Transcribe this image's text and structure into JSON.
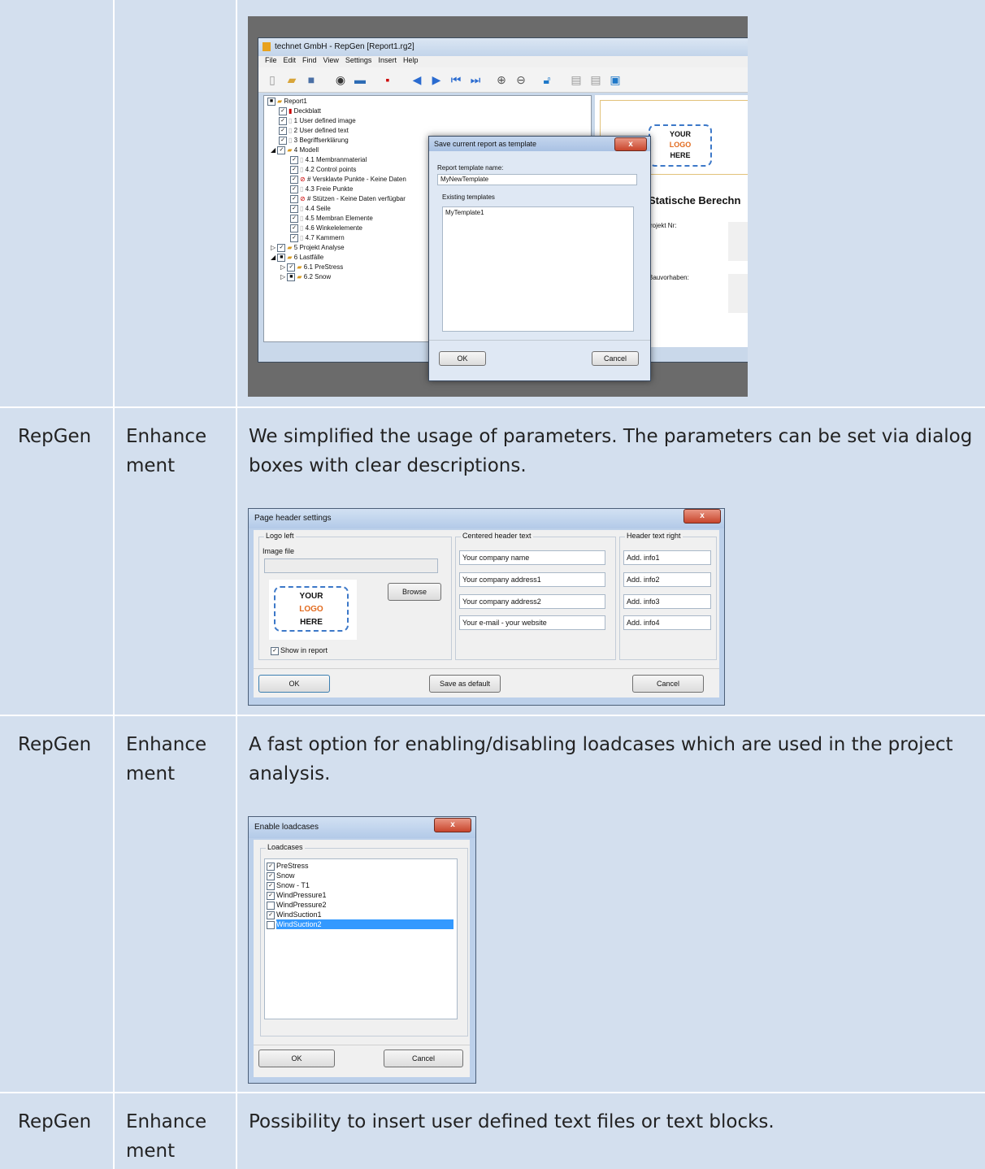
{
  "rows": [
    {
      "module": "RepGen",
      "type": "Enhance ment",
      "description": "We simplified the usage of parameters. The parameters can be set via dialog boxes with clear descriptions."
    },
    {
      "module": "RepGen",
      "type": "Enhance ment",
      "description": "A fast option for enabling/disabling loadcases which are used in the project analysis."
    },
    {
      "module": "RepGen",
      "type": "Enhance ment",
      "description": "Possibility to insert user defined text files or text blocks."
    }
  ],
  "shot1": {
    "window_title": "technet GmbH - RepGen [Report1.rg2]",
    "menu": [
      "File",
      "Edit",
      "Find",
      "View",
      "Settings",
      "Insert",
      "Help"
    ],
    "tree": [
      "Report1",
      "Deckblatt",
      "1 User defined image",
      "2 User defined text",
      "3 Begriffserklärung",
      "4 Modell",
      "4.1 Membranmaterial",
      "4.2 Control points",
      "# Versklavte Punkte - Keine Daten",
      "4.3 Freie Punkte",
      "# Stützen - Keine Daten verfügbar",
      "4.4 Seile",
      "4.5 Membran Elemente",
      "4.6 Winkelelemente",
      "4.7 Kammern",
      "5 Projekt Analyse",
      "6 Lastfälle",
      "6.1 PreStress",
      "6.2 Snow"
    ],
    "preview": {
      "logo": [
        "YOUR",
        "LOGO",
        "HERE"
      ],
      "heading": "Statische Berechn",
      "projekt": "rojekt Nr:",
      "bauvorhaben": "Bauvorhaben:"
    },
    "dialog": {
      "title": "Save current report as template",
      "name_label": "Report template name:",
      "name_value": "MyNewTemplate",
      "existing_label": "Existing templates",
      "templates": [
        "MyTemplate1"
      ],
      "ok": "OK",
      "cancel": "Cancel"
    }
  },
  "shot2": {
    "title": "Page header settings",
    "logo_left": "Logo left",
    "image_file": "Image file",
    "browse": "Browse",
    "logo": [
      "YOUR",
      "LOGO",
      "HERE"
    ],
    "show_in_report": "Show in report",
    "centered": "Centered header text",
    "centered_fields": [
      "Your company name",
      "Your company address1",
      "Your company address2",
      "Your e-mail - your website"
    ],
    "right": "Header text right",
    "right_fields": [
      "Add. info1",
      "Add. info2",
      "Add. info3",
      "Add. info4"
    ],
    "ok": "OK",
    "save_default": "Save as default",
    "cancel": "Cancel"
  },
  "shot3": {
    "title": "Enable loadcases",
    "group": "Loadcases",
    "items": [
      {
        "label": "PreStress",
        "checked": true
      },
      {
        "label": "Snow",
        "checked": true
      },
      {
        "label": "Snow - T1",
        "checked": true
      },
      {
        "label": "WindPressure1",
        "checked": true
      },
      {
        "label": "WindPressure2",
        "checked": false
      },
      {
        "label": "WindSuction1",
        "checked": true
      },
      {
        "label": "WindSuction2",
        "checked": false
      }
    ],
    "ok": "OK",
    "cancel": "Cancel"
  }
}
